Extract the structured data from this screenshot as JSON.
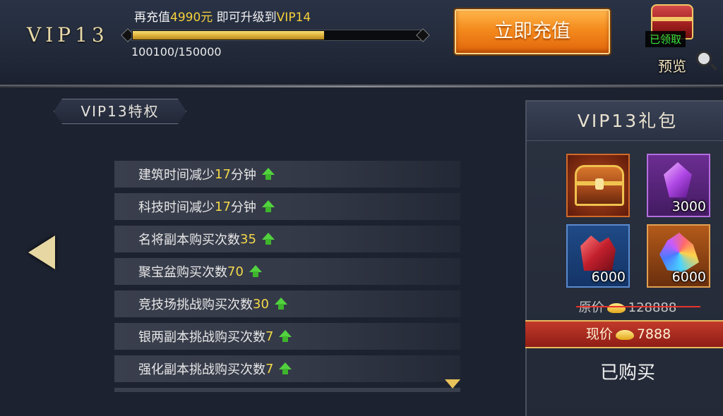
{
  "header": {
    "vip_level": "VIP13",
    "upgrade_prefix": "再充值",
    "upgrade_amount": "4990元",
    "upgrade_suffix": " 即可升级到",
    "upgrade_target": "VIP14",
    "progress_text": "100100/150000",
    "progress_fraction": 0.667,
    "recharge_label": "立即充值",
    "claimed_label": "已领取",
    "preview_label": "预览"
  },
  "privileges": {
    "title": "VIP13特权",
    "items": [
      {
        "text": "建筑时间减少",
        "value": "17",
        "unit": "分钟"
      },
      {
        "text": "科技时间减少",
        "value": "17",
        "unit": "分钟"
      },
      {
        "text": "名将副本购买次数",
        "value": "35",
        "unit": ""
      },
      {
        "text": "聚宝盆购买次数",
        "value": "70",
        "unit": ""
      },
      {
        "text": "竞技场挑战购买次数",
        "value": "30",
        "unit": ""
      },
      {
        "text": "银两副本挑战购买次数",
        "value": "7",
        "unit": ""
      },
      {
        "text": "强化副本挑战购买次数",
        "value": "7",
        "unit": ""
      }
    ]
  },
  "gift": {
    "title": "VIP13礼包",
    "items": [
      {
        "icon": "treasure-chest",
        "amount": ""
      },
      {
        "icon": "purple-gem",
        "amount": "3000"
      },
      {
        "icon": "red-crystal",
        "amount": "6000"
      },
      {
        "icon": "multicolor-crystal",
        "amount": "6000"
      }
    ],
    "original_label": "原价",
    "original_price": "128888",
    "current_label": "现价",
    "current_price": "7888",
    "status": "已购买"
  },
  "colors": {
    "highlight": "#f6d23c",
    "up_arrow": "#52d23f",
    "recharge_button": "#f48a1d",
    "price_bar": "#c23a2a"
  }
}
